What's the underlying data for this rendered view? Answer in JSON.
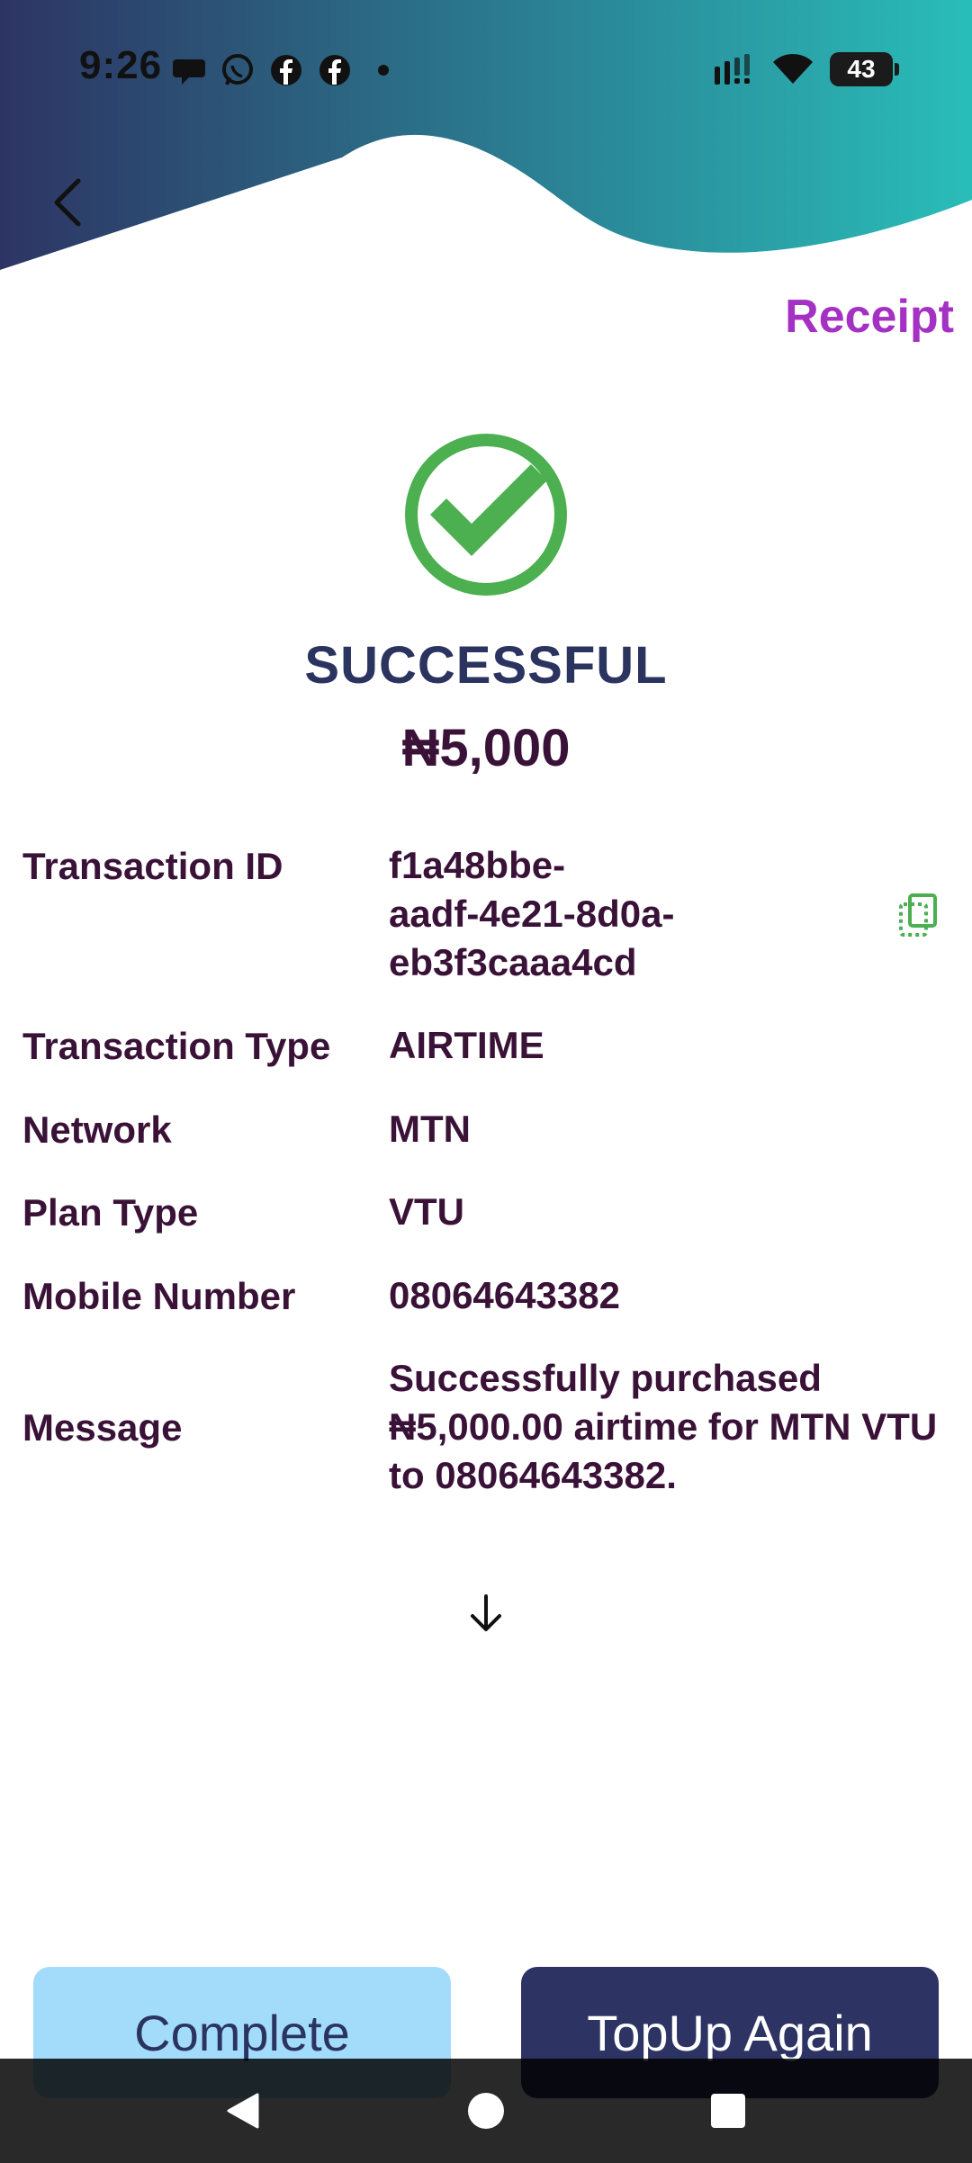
{
  "status_bar": {
    "time": "9:26",
    "battery": "43",
    "left_icons": [
      "chat-bubble-icon",
      "whatsapp-icon",
      "facebook-icon",
      "facebook-icon",
      "dot-icon"
    ],
    "right_icons": [
      "signal-icon",
      "wifi-icon",
      "battery-icon"
    ]
  },
  "header": {
    "back_icon": "chevron-left-icon",
    "receipt_label": "Receipt",
    "gradient_start": "#2d3463",
    "gradient_end": "#29bdb9"
  },
  "result": {
    "status": "SUCCESSFUL",
    "amount": "₦5,000",
    "icon": "check-circle-icon",
    "icon_color": "#4caf50"
  },
  "details": [
    {
      "label": "Transaction ID",
      "value_lines": [
        "f1a48bbe-",
        "aadf-4e21-8d0a-",
        "eb3f3caaa4cd"
      ]
    },
    {
      "label": "Transaction Type",
      "value_lines": [
        "AIRTIME"
      ]
    },
    {
      "label": "Network",
      "value_lines": [
        "MTN"
      ]
    },
    {
      "label": "Plan Type",
      "value_lines": [
        "VTU"
      ]
    },
    {
      "label": "Mobile Number",
      "value_lines": [
        "08064643382"
      ]
    },
    {
      "label": "Message",
      "value_lines": [
        "Successfully purchased",
        "₦5,000.00 airtime for MTN VTU",
        "to 08064643382."
      ]
    }
  ],
  "scroll_icon": "arrow-down-icon",
  "buttons": {
    "complete": "Complete",
    "topup": "TopUp Again"
  },
  "nav": {
    "back_icon": "triangle-back-icon",
    "home_icon": "circle-home-icon",
    "recents_icon": "square-recents-icon"
  }
}
